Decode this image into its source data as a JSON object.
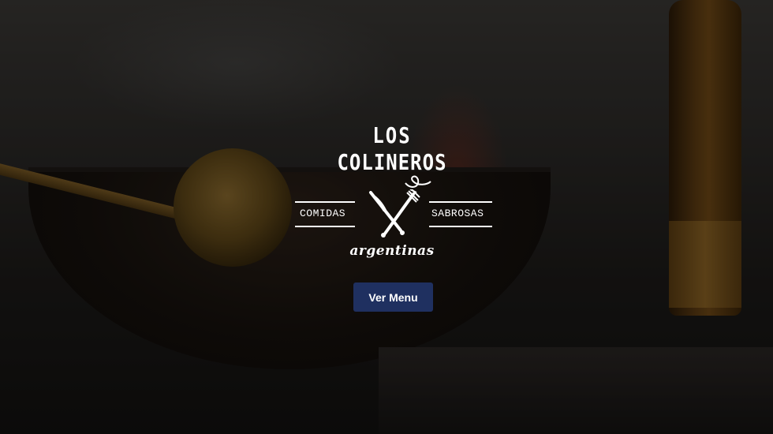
{
  "logo": {
    "line1": "LOS",
    "line2": "COLINEROS",
    "tag_left": "COMIDAS",
    "tag_right": "SABROSAS",
    "script": "argentinas",
    "icon": "fork-knife-icon"
  },
  "hero": {
    "cta_label": "Ver Menu",
    "cta_color": "#1f3060"
  }
}
